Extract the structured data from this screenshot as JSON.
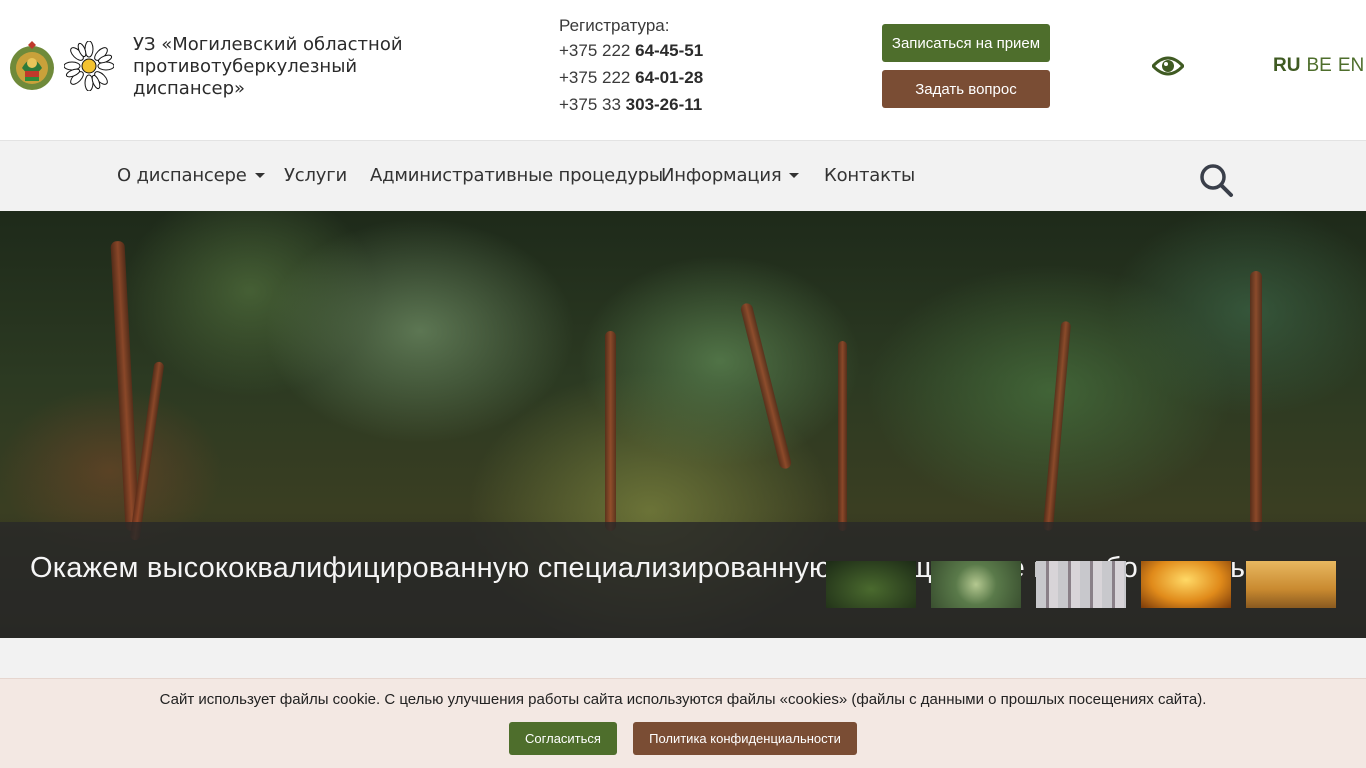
{
  "header": {
    "org_name": "УЗ «Могилевский областной противотуберкулезный диспансер»",
    "registry_label": "Регистратура:",
    "phones": [
      {
        "prefix": "+375 222 ",
        "number": "64-45-51"
      },
      {
        "prefix": "+375 222 ",
        "number": "64-01-28"
      },
      {
        "prefix": "+375 33 ",
        "number": "303-26-11"
      }
    ],
    "appointment_button": "Записаться на прием",
    "question_button": "Задать вопрос",
    "languages": [
      "RU",
      "BE",
      "EN"
    ],
    "active_language": "RU"
  },
  "nav": {
    "items": [
      {
        "label": "О диспансере",
        "dropdown": true
      },
      {
        "label": "Услуги",
        "dropdown": false
      },
      {
        "label": "Административные процедуры",
        "dropdown": false
      },
      {
        "label": "Информация",
        "dropdown": true
      },
      {
        "label": "Контакты",
        "dropdown": false
      }
    ],
    "search_icon": "search-icon"
  },
  "hero": {
    "caption": "Окажем высококвалифицированную специализированную помощь даже в особо сложных",
    "thumbnails": [
      "forest-thumbnail",
      "pine-needles-thumbnail",
      "misty-forest-thumbnail",
      "sunlit-path-thumbnail",
      "sunny-forest-thumbnail"
    ]
  },
  "cookie": {
    "text": "Сайт использует файлы cookie. С целью улучшения работы сайта используются файлы «cookies» (файлы с данными о прошлых посещениях сайта).",
    "agree_button": "Согласиться",
    "policy_button": "Политика конфиденциальности"
  },
  "colors": {
    "green": "#4e6e2c",
    "brown": "#7a4d34",
    "nav_bg": "#f2f2f2",
    "cookie_bg": "#f3e8e3"
  }
}
